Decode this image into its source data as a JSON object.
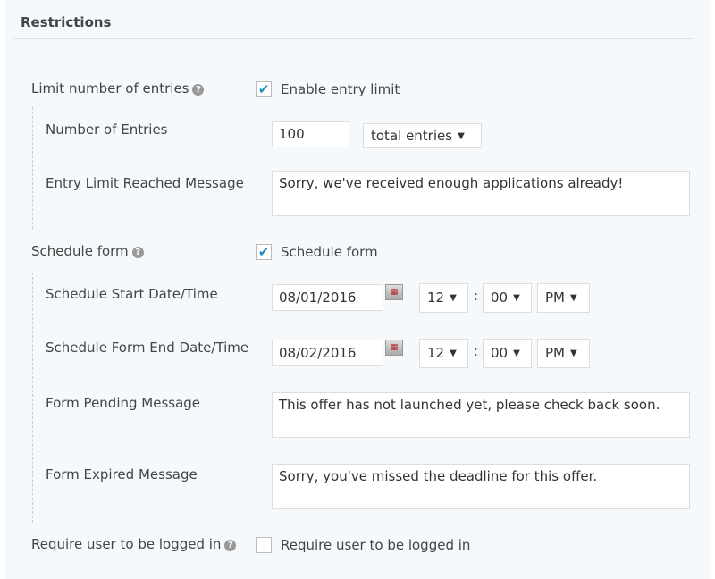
{
  "section_title": "Restrictions",
  "limit": {
    "label": "Limit number of entries",
    "checkbox_label": "Enable entry limit",
    "checked": true,
    "number_label": "Number of Entries",
    "number_value": "100",
    "period_value": "total entries",
    "message_label": "Entry Limit Reached Message",
    "message_value": "Sorry, we've received enough applications already!"
  },
  "schedule": {
    "label": "Schedule form",
    "checkbox_label": "Schedule form",
    "checked": true,
    "start_label": "Schedule Start Date/Time",
    "start_date": "08/01/2016",
    "start_hour": "12",
    "start_minute": "00",
    "start_ampm": "PM",
    "end_label": "Schedule Form End Date/Time",
    "end_date": "08/02/2016",
    "end_hour": "12",
    "end_minute": "00",
    "end_ampm": "PM",
    "pending_label": "Form Pending Message",
    "pending_value": "This offer has not launched yet, please check back soon.",
    "expired_label": "Form Expired Message",
    "expired_value": "Sorry, you've missed the deadline for this offer."
  },
  "login": {
    "label": "Require user to be logged in",
    "checkbox_label": "Require user to be logged in",
    "checked": false
  },
  "colon": ":",
  "help_glyph": "?",
  "check_glyph": "✔",
  "arrow_glyph": "▼",
  "calendar_glyph": "▦",
  "colors": {
    "accent": "#1e8cbe",
    "panel_bg": "#f5f9fc"
  }
}
